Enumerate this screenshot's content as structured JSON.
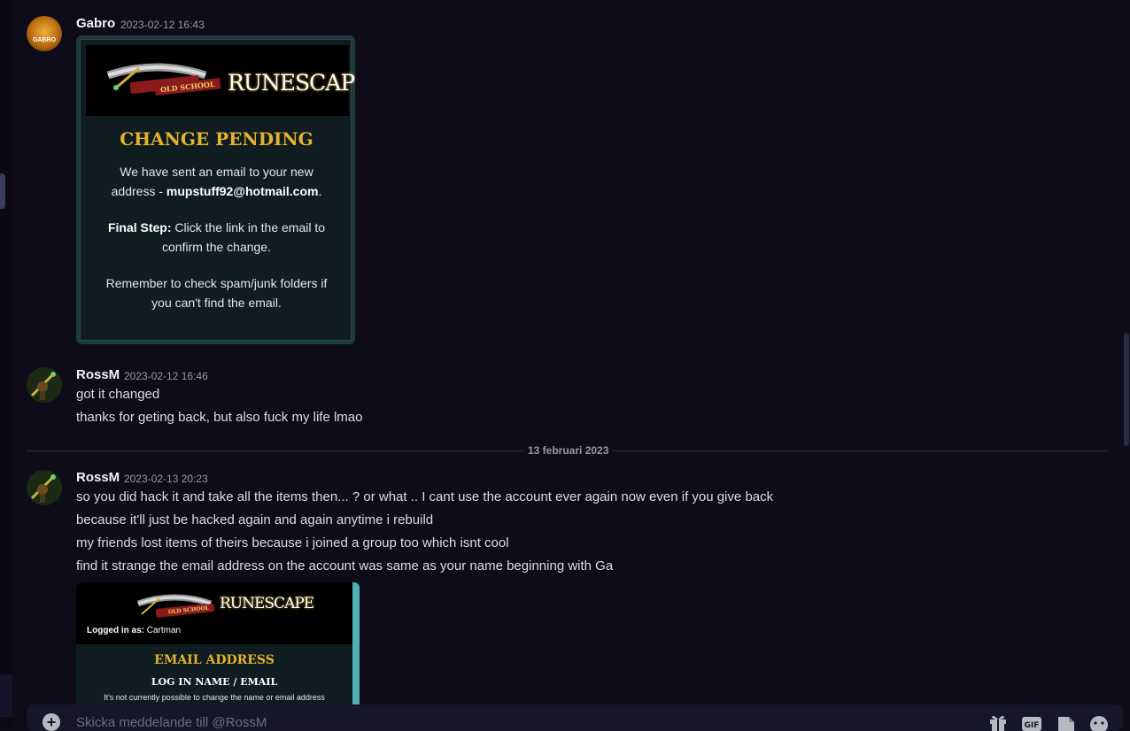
{
  "messages": [
    {
      "username": "Gabro",
      "timestamp": "2023-02-12 16:43",
      "avatar_text": "GABRO",
      "image": {
        "logo_text": "OLD SCHOOL",
        "brand_text": "RUNESCAPE",
        "title": "CHANGE PENDING",
        "para1_a": "We have sent an email to your new",
        "para1_b": "address - ",
        "para1_email": "mupstuff92@hotmail.com",
        "para1_end": ".",
        "para2_label": "Final Step:",
        "para2_a": " Click the link in the email to",
        "para2_b": "confirm the change.",
        "para3_a": "Remember to check spam/junk folders if",
        "para3_b": "you can't find the email."
      }
    },
    {
      "username": "RossM",
      "timestamp": "2023-02-12 16:46",
      "lines": [
        "got it changed",
        "thanks for geting back, but also fuck my life lmao"
      ]
    },
    {
      "username": "RossM",
      "timestamp": "2023-02-13 20:23",
      "lines": [
        "so you did hack it and take all the items then... ? or what .. I cant use the account ever again now even if you give back",
        "because it'll just be hacked again and again anytime i rebuild",
        "my friends lost items of theirs because i joined a group too which isnt cool",
        "find it strange the email address on the account was same as your name beginning with Ga"
      ],
      "image": {
        "logo_text": "OLD SCHOOL",
        "brand_text": "RUNESCAPE",
        "logged_label": "Logged in as:",
        "logged_user": " Cartman",
        "title": "EMAIL ADDRESS",
        "subtitle": "LOG IN NAME / EMAIL",
        "note": "It's not currently possible to change the name or email address"
      }
    }
  ],
  "date_divider": "13 februari 2023",
  "composer": {
    "placeholder": "Skicka meddelande till @RossM"
  },
  "icons": [
    "add-icon",
    "gift-icon",
    "gif-icon",
    "sticker-icon",
    "emoji-icon"
  ],
  "colors": {
    "background": "#0d0c18",
    "gold_title": "#e6b22e",
    "timestamp": "#949ba4"
  }
}
